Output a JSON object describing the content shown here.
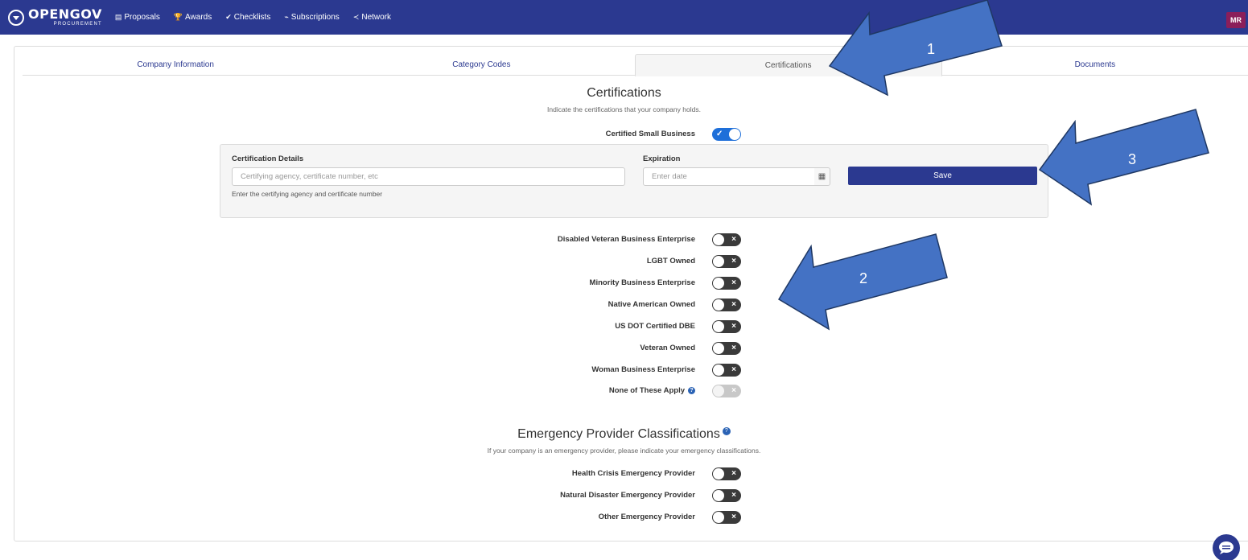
{
  "app": {
    "logo_main": "OPENGOV",
    "logo_sub": "PROCUREMENT",
    "avatar_initials": "MR",
    "brand_color": "#2b3990"
  },
  "nav": [
    {
      "label": "Proposals",
      "icon": "document-icon"
    },
    {
      "label": "Awards",
      "icon": "trophy-icon"
    },
    {
      "label": "Checklists",
      "icon": "check-icon"
    },
    {
      "label": "Subscriptions",
      "icon": "rss-icon"
    },
    {
      "label": "Network",
      "icon": "share-icon"
    }
  ],
  "tabs": [
    {
      "label": "Company Information"
    },
    {
      "label": "Category Codes"
    },
    {
      "label": "Certifications",
      "active": true
    },
    {
      "label": "Documents"
    }
  ],
  "certifications": {
    "title": "Certifications",
    "subtitle": "Indicate the certifications that your company holds.",
    "small_business": {
      "label": "Certified Small Business",
      "on": true
    },
    "details": {
      "label": "Certification Details",
      "placeholder": "Certifying agency, certificate number, etc",
      "help": "Enter the certifying agency and certificate number",
      "expiration_label": "Expiration",
      "expiration_placeholder": "Enter date",
      "save_label": "Save"
    },
    "items": [
      {
        "label": "Disabled Veteran Business Enterprise",
        "on": false
      },
      {
        "label": "LGBT Owned",
        "on": false
      },
      {
        "label": "Minority Business Enterprise",
        "on": false
      },
      {
        "label": "Native American Owned",
        "on": false
      },
      {
        "label": "US DOT Certified DBE",
        "on": false
      },
      {
        "label": "Veteran Owned",
        "on": false
      },
      {
        "label": "Woman Business Enterprise",
        "on": false
      },
      {
        "label": "None of These Apply",
        "on": false,
        "disabled": true,
        "help": true
      }
    ]
  },
  "emergency": {
    "title": "Emergency Provider Classifications",
    "subtitle": "If your company is an emergency provider, please indicate your emergency classifications.",
    "items": [
      {
        "label": "Health Crisis Emergency Provider",
        "on": false
      },
      {
        "label": "Natural Disaster Emergency Provider",
        "on": false
      },
      {
        "label": "Other Emergency Provider",
        "on": false
      }
    ]
  },
  "annotations": {
    "arrow_color": "#4472c4",
    "labels": [
      "1",
      "2",
      "3"
    ]
  }
}
